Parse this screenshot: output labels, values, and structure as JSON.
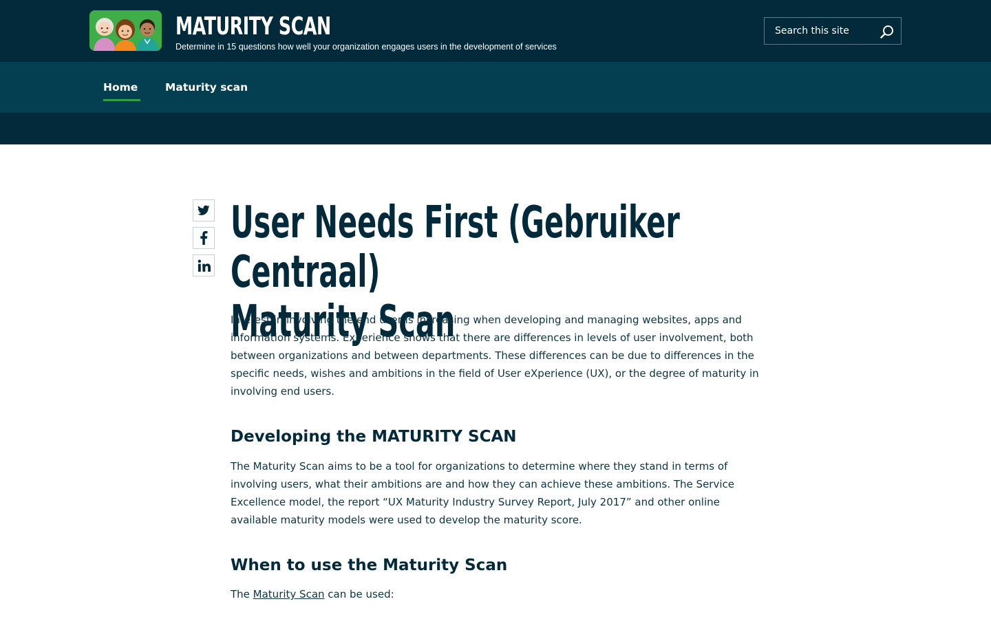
{
  "header": {
    "title": "MATURITY SCAN",
    "subtitle": "Determine in 15 questions how well your organization engages users in the development of services",
    "logo_icon": "three-people-logo",
    "search": {
      "placeholder": "Search this site",
      "icon": "search-icon"
    }
  },
  "nav": {
    "items": [
      {
        "label": "Home",
        "active": true
      },
      {
        "label": "Maturity scan",
        "active": false
      }
    ]
  },
  "share": {
    "items": [
      {
        "name": "twitter",
        "icon": "twitter-icon"
      },
      {
        "name": "facebook",
        "icon": "facebook-icon"
      },
      {
        "name": "linkedin",
        "icon": "linkedin-icon"
      }
    ]
  },
  "content": {
    "title_line1": "User Needs First (Gebruiker Centraal)",
    "title_line2": "Maturity Scan",
    "intro": "Interest in involving the end user is increasing when developing and managing websites, apps and information systems. Experience shows that there are differences in levels of user involvement, both between organizations and between departments. These differences can be due to differences in the specific needs, wishes and ambitions in the field of User eXperience (UX), or the degree of maturity in involving end users.",
    "section1": {
      "heading": "Developing the MATURITY SCAN",
      "text": "The Maturity Scan aims to be a tool for organizations to determine where they stand in terms of involving users, what their ambitions are and how they can achieve these ambitions. The Service Excellence model, the report “UX Maturity Industry Survey Report, July 2017” and other online available maturity models were used to develop the maturity score."
    },
    "section2": {
      "heading": "When to use the Maturity Scan",
      "text_before": "The ",
      "link": "Maturity Scan",
      "text_after": " can be used:"
    }
  },
  "colors": {
    "header_bg": "#032a3b",
    "nav_bg": "#033f51",
    "active_underline": "#2f9e44",
    "heading": "#032a3b"
  }
}
